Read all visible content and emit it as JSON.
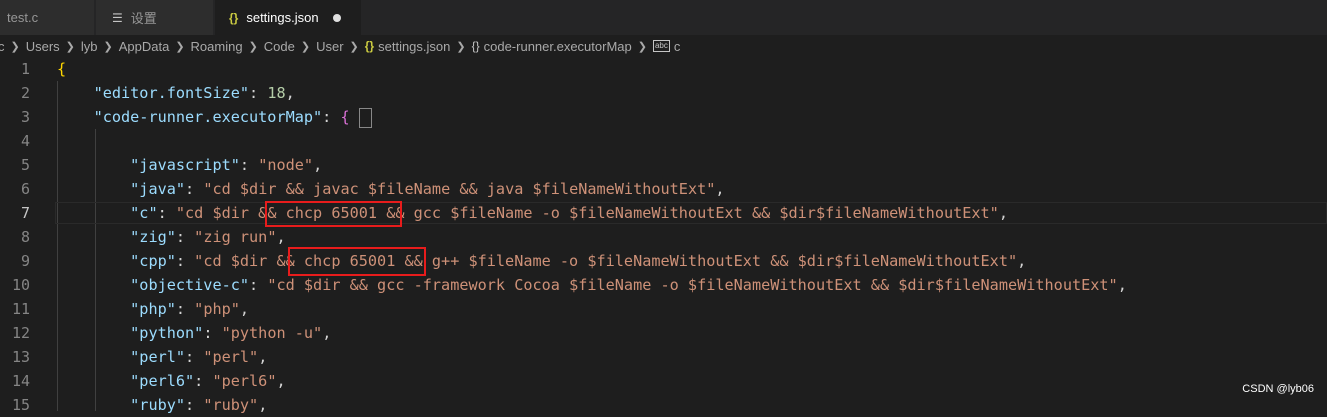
{
  "tabs": [
    {
      "label": "test.c",
      "icon": "c-file-icon"
    },
    {
      "label": "设置",
      "icon": "settings-list-icon"
    },
    {
      "label": "settings.json",
      "icon": "json-braces-icon",
      "modified": true
    }
  ],
  "breadcrumb": [
    "c",
    "Users",
    "lyb",
    "AppData",
    "Roaming",
    "Code",
    "User",
    "settings.json",
    "code-runner.executorMap",
    "c"
  ],
  "line_numbers": [
    "1",
    "2",
    "3",
    "4",
    "5",
    "6",
    "7",
    "8",
    "9",
    "10",
    "11",
    "12",
    "13",
    "14",
    "15"
  ],
  "current_line": "7",
  "code": {
    "l1": "{",
    "l2_key": "\"editor.fontSize\"",
    "l2_val": "18",
    "l3_key": "\"code-runner.executorMap\"",
    "l3_val": "{",
    "l5_key": "\"javascript\"",
    "l5_val": "\"node\"",
    "l6_key": "\"java\"",
    "l6_val": "\"cd $dir && javac $fileName && java $fileNameWithoutExt\"",
    "l7_key": "\"c\"",
    "l7_val": "\"cd $dir && chcp 65001 && gcc $fileName -o $fileNameWithoutExt && $dir$fileNameWithoutExt\"",
    "l8_key": "\"zig\"",
    "l8_val": "\"zig run\"",
    "l9_key": "\"cpp\"",
    "l9_val": "\"cd $dir && chcp 65001 && g++ $fileName -o $fileNameWithoutExt && $dir$fileNameWithoutExt\"",
    "l10_key": "\"objective-c\"",
    "l10_val": "\"cd $dir && gcc -framework Cocoa $fileName -o $fileNameWithoutExt && $dir$fileNameWithoutExt\"",
    "l11_key": "\"php\"",
    "l11_val": "\"php\"",
    "l12_key": "\"python\"",
    "l12_val": "\"python -u\"",
    "l13_key": "\"perl\"",
    "l13_val": "\"perl\"",
    "l14_key": "\"perl6\"",
    "l14_val": "\"perl6\"",
    "l15_key": "\"ruby\"",
    "l15_val": "\"ruby\""
  },
  "watermark": "CSDN @lyb06"
}
